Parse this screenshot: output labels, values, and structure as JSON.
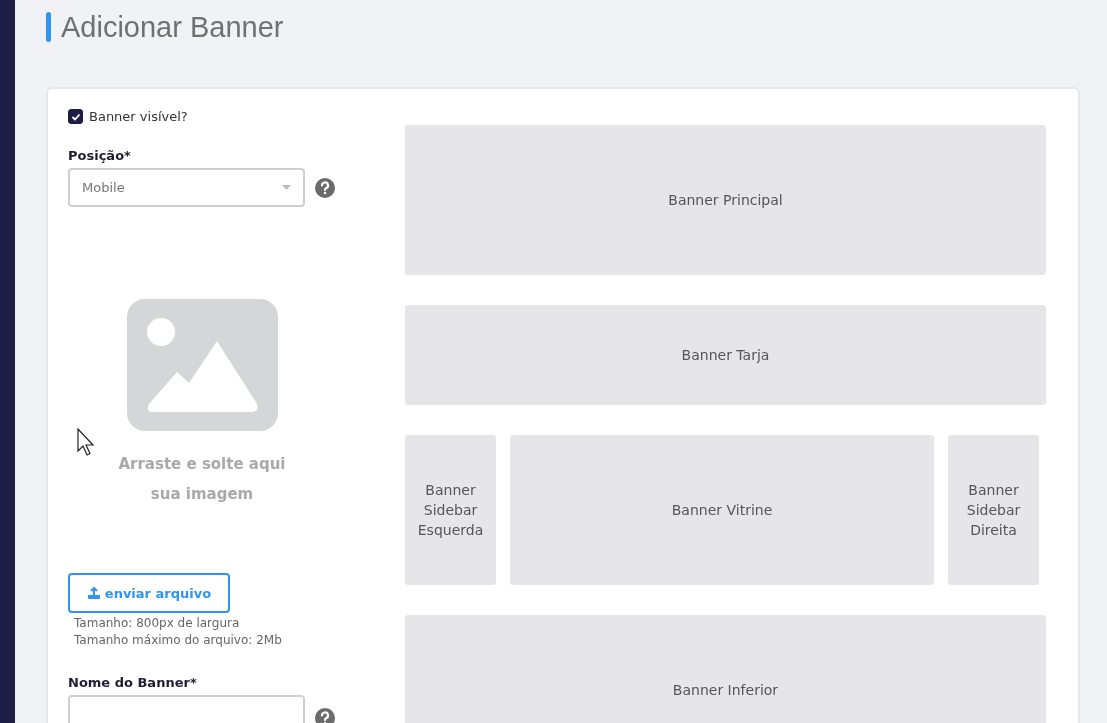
{
  "page": {
    "title": "Adicionar Banner"
  },
  "form": {
    "visible": {
      "label": "Banner visível?",
      "checked": true
    },
    "position": {
      "label": "Posição*",
      "value": "Mobile"
    },
    "dropzone": {
      "text_1": "Arraste e solte aqui",
      "text_2": "sua imagem"
    },
    "upload_button": "enviar arquivo",
    "hints": [
      "Tamanho: 800px de largura",
      "Tamanho máximo do arquivo: 2Mb"
    ],
    "name": {
      "label": "Nome do Banner*"
    }
  },
  "preview": {
    "rows": [
      [
        {
          "label": "Banner Principal",
          "kind": "full"
        }
      ],
      [
        {
          "label": "Banner Tarja",
          "kind": "strip"
        }
      ],
      [
        {
          "label": "Banner Sidebar Esquerda",
          "kind": "side"
        },
        {
          "label": "Banner Vitrine",
          "kind": "main"
        },
        {
          "label": "Banner Sidebar Direita",
          "kind": "side"
        }
      ],
      [
        {
          "label": "Banner Inferior",
          "kind": "full"
        }
      ]
    ]
  }
}
